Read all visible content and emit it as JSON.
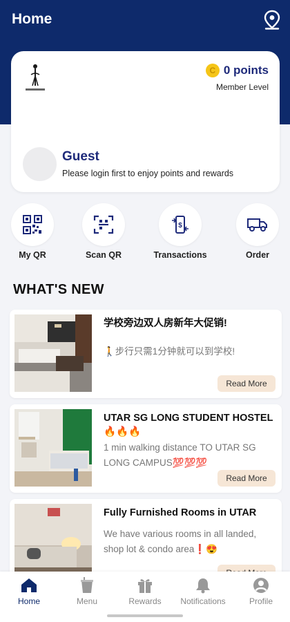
{
  "header": {
    "title": "Home",
    "location_icon": "location-pin-icon"
  },
  "card": {
    "points_value": "0 points",
    "member_level": "Member Level",
    "guest_name": "Guest",
    "login_prompt": "Please login first to enjoy points and rewards"
  },
  "actions": [
    {
      "label": "My QR",
      "icon": "qr-code-icon"
    },
    {
      "label": "Scan QR",
      "icon": "scan-qr-icon"
    },
    {
      "label": "Transactions",
      "icon": "transactions-icon"
    },
    {
      "label": "Order",
      "icon": "delivery-truck-icon"
    }
  ],
  "whats_new": {
    "heading": "WHAT'S NEW",
    "items": [
      {
        "title": "学校旁边双人房新年大促销!",
        "desc": "🚶步行只需1分钟就可以到学校!",
        "button": "Read More"
      },
      {
        "title": "UTAR SG LONG STUDENT HOSTEL 🔥🔥🔥",
        "desc": "1 min walking distance TO UTAR SG LONG CAMPUS💯💯💯",
        "button": "Read More"
      },
      {
        "title": "Fully Furnished Rooms in UTAR",
        "desc": "We have various rooms in all landed, shop lot & condo area❗😍",
        "button": "Read More"
      }
    ]
  },
  "nav": [
    {
      "label": "Home",
      "icon": "home-icon",
      "active": true
    },
    {
      "label": "Menu",
      "icon": "menu-cup-icon"
    },
    {
      "label": "Rewards",
      "icon": "gift-icon"
    },
    {
      "label": "Notifications",
      "icon": "bell-icon"
    },
    {
      "label": "Profile",
      "icon": "profile-icon"
    }
  ],
  "colors": {
    "brand": "#0e2a6b",
    "accent": "#1e2a7a",
    "read_more_bg": "#f6e6d6",
    "coin": "#f5c518"
  }
}
